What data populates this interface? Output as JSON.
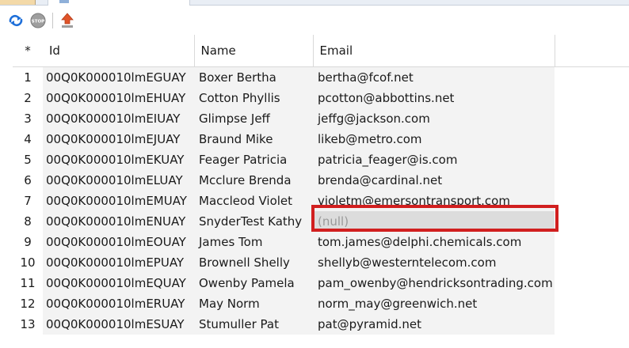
{
  "toolbar": {
    "refresh_icon": "refresh-icon",
    "stop_icon": "stop-icon",
    "stop_label": "STOP",
    "export_icon": "upload-icon"
  },
  "grid": {
    "columns": {
      "rownum": "*",
      "id": "Id",
      "name": "Name",
      "email": "Email"
    },
    "rows": [
      {
        "n": "1",
        "id": "00Q0K000010lmEGUAY",
        "name": "Boxer Bertha",
        "email": "bertha@fcof.net"
      },
      {
        "n": "2",
        "id": "00Q0K000010lmEHUAY",
        "name": "Cotton Phyllis",
        "email": "pcotton@abbottins.net"
      },
      {
        "n": "3",
        "id": "00Q0K000010lmEIUAY",
        "name": "Glimpse Jeff",
        "email": "jeffg@jackson.com"
      },
      {
        "n": "4",
        "id": "00Q0K000010lmEJUAY",
        "name": "Braund Mike",
        "email": "likeb@metro.com"
      },
      {
        "n": "5",
        "id": "00Q0K000010lmEKUAY",
        "name": "Feager Patricia",
        "email": "patricia_feager@is.com"
      },
      {
        "n": "6",
        "id": "00Q0K000010lmELUAY",
        "name": "Mcclure Brenda",
        "email": "brenda@cardinal.net"
      },
      {
        "n": "7",
        "id": "00Q0K000010lmEMUAY",
        "name": "Maccleod Violet",
        "email": "violetm@emersontransport.com"
      },
      {
        "n": "8",
        "id": "00Q0K000010lmENUAY",
        "name": "SnyderTest Kathy",
        "email": "(null)"
      },
      {
        "n": "9",
        "id": "00Q0K000010lmEOUAY",
        "name": "James Tom",
        "email": "tom.james@delphi.chemicals.com"
      },
      {
        "n": "10",
        "id": "00Q0K000010lmEPUAY",
        "name": "Brownell Shelly",
        "email": "shellyb@westerntelecom.com"
      },
      {
        "n": "11",
        "id": "00Q0K000010lmEQUAY",
        "name": "Owenby Pamela",
        "email": "pam_owenby@hendricksontrading.com"
      },
      {
        "n": "12",
        "id": "00Q0K000010lmERUAY",
        "name": "May Norm",
        "email": "norm_may@greenwich.net"
      },
      {
        "n": "13",
        "id": "00Q0K000010lmESUAY",
        "name": "Stumuller Pat",
        "email": "pat@pyramid.net"
      }
    ],
    "null_row_index": 7
  },
  "colors": {
    "cell_bg": "#f3f3f3",
    "null_bg": "#dcdcdc",
    "null_text": "#9a9a9a",
    "highlight": "#d11f1f",
    "refresh_blue": "#1e6fd9",
    "upload_orange": "#e0542a"
  }
}
